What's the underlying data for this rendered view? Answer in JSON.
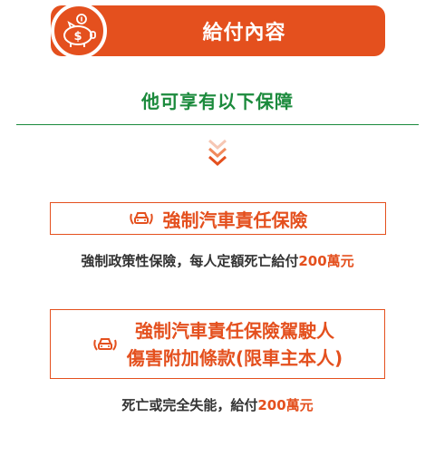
{
  "header": {
    "title": "給付內容",
    "icon": "piggy-bank-icon",
    "accent": "#e4501e"
  },
  "subtitle": "他可享有以下保障",
  "divider_color": "#1b8a3c",
  "coverages": [
    {
      "title": "強制汽車責任保險",
      "icon": "car-hands-icon",
      "desc_prefix": "強制政策性保險，每人定額死亡給付",
      "desc_amount": "200萬元"
    },
    {
      "title_line1": "強制汽車責任保險駕駛人",
      "title_line2": "傷害附加條款(限車主本人)",
      "icon": "car-hands-icon",
      "desc_prefix": "死亡或完全失能，給付",
      "desc_amount": "200萬元"
    }
  ]
}
